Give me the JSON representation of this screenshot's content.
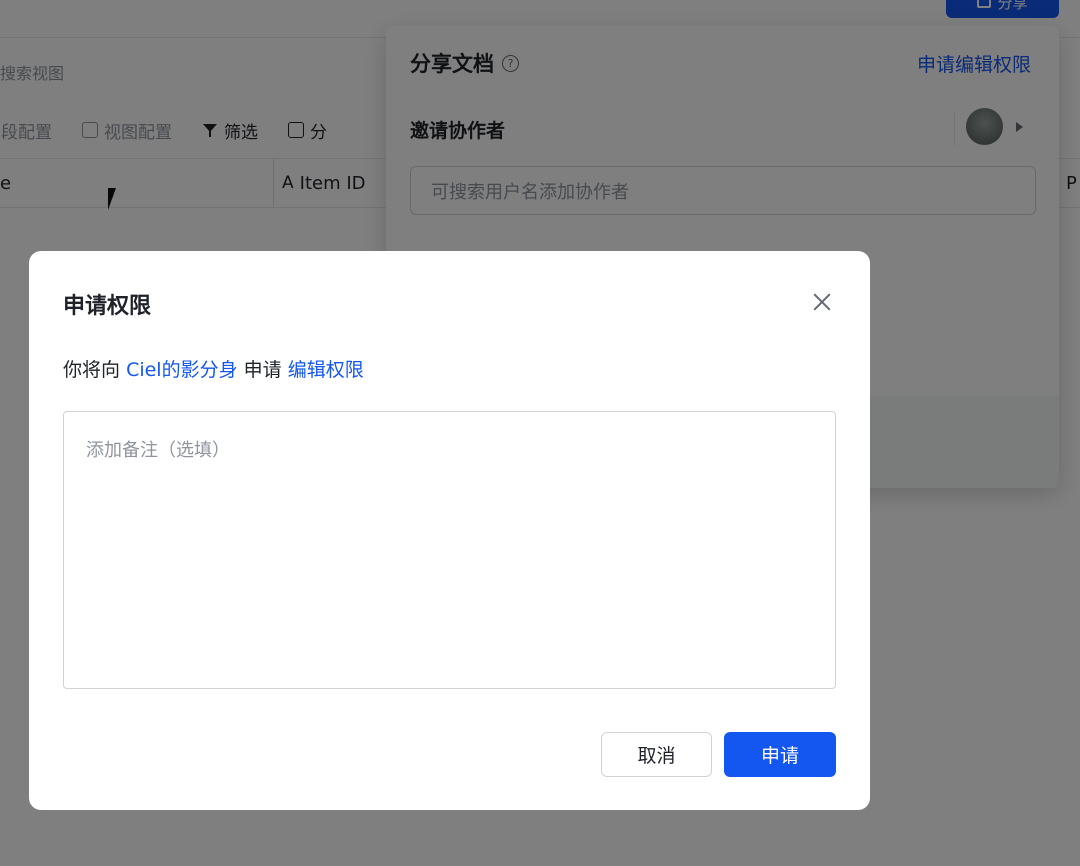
{
  "background": {
    "share_button_label": "分享",
    "view_search_text": "搜索视图",
    "toolbar": {
      "field_config": "字段配置",
      "view_config": "视图配置",
      "filter": "筛选",
      "group": "分"
    },
    "table_headers": [
      "e",
      "Item ID",
      "P"
    ],
    "share_panel": {
      "title": "分享文档",
      "request_edit_link": "申请编辑权限",
      "invite_label": "邀请协作者",
      "search_placeholder": "可搜索用户名添加协作者"
    }
  },
  "modal": {
    "title": "申请权限",
    "desc_prefix": "你将向",
    "desc_user": "Ciel的影分身",
    "desc_middle": "申请",
    "desc_permission": "编辑权限",
    "textarea_placeholder": "添加备注（选填）",
    "textarea_value": "",
    "cancel_label": "取消",
    "confirm_label": "申请"
  },
  "colors": {
    "accent": "#1456f0",
    "overlay": "rgba(0,0,0,0.5)"
  },
  "icons": [
    "close-icon",
    "help-icon",
    "filter-icon",
    "cursor-icon"
  ]
}
